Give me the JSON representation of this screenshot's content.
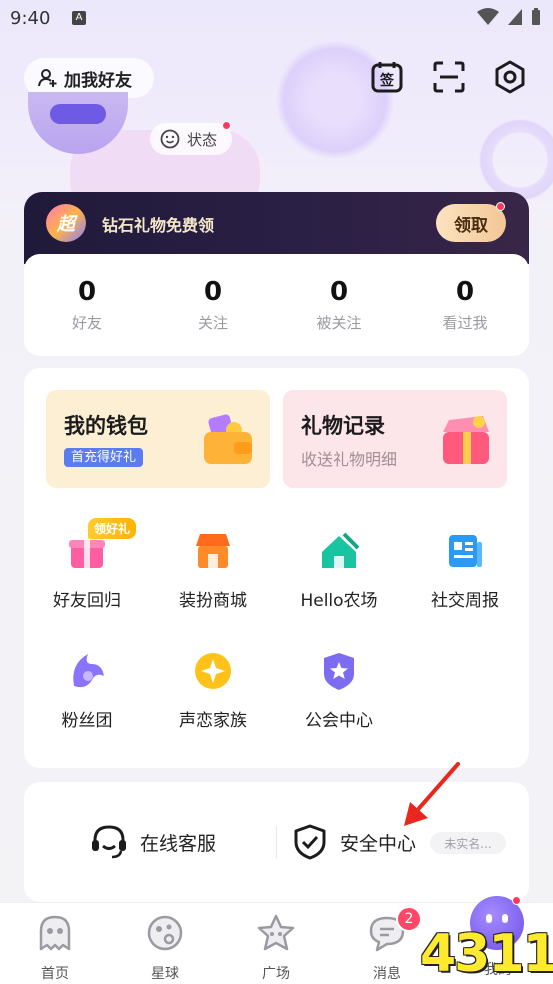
{
  "status_bar": {
    "time": "9:40",
    "notif_icon": "A"
  },
  "header": {
    "add_friend_label": "加我好友",
    "icons": [
      "calendar-sign-icon",
      "scan-icon",
      "settings-hex-icon"
    ],
    "status_label": "状态"
  },
  "promo": {
    "text": "钻石礼物免费领",
    "logo_text": "超",
    "claim_label": "领取"
  },
  "stats": [
    {
      "value": "0",
      "label": "好友"
    },
    {
      "value": "0",
      "label": "关注"
    },
    {
      "value": "0",
      "label": "被关注"
    },
    {
      "value": "0",
      "label": "看过我"
    }
  ],
  "features": {
    "wallet": {
      "title": "我的钱包",
      "badge": "首充得好礼"
    },
    "gifts": {
      "title": "礼物记录",
      "sub": "收送礼物明细"
    }
  },
  "grid": {
    "tag": "领好礼",
    "items": [
      {
        "label": "好友回归",
        "icon": "gift-box-icon"
      },
      {
        "label": "装扮商城",
        "icon": "shop-icon"
      },
      {
        "label": "Hello农场",
        "icon": "farm-icon"
      },
      {
        "label": "社交周报",
        "icon": "report-icon"
      },
      {
        "label": "粉丝团",
        "icon": "wing-icon"
      },
      {
        "label": "声恋家族",
        "icon": "star-badge-icon"
      },
      {
        "label": "公会中心",
        "icon": "shield-star-icon"
      }
    ]
  },
  "support": {
    "online_service": "在线客服",
    "security_center": "安全中心",
    "unverified": "未实名..."
  },
  "nav": {
    "items": [
      {
        "label": "首页",
        "icon": "ghost-icon"
      },
      {
        "label": "星球",
        "icon": "planet-icon"
      },
      {
        "label": "广场",
        "icon": "star-face-icon"
      },
      {
        "label": "消息",
        "icon": "chat-icon"
      },
      {
        "label": "我的",
        "icon": "me-icon"
      }
    ],
    "message_badge": "2"
  },
  "watermark": "4311"
}
